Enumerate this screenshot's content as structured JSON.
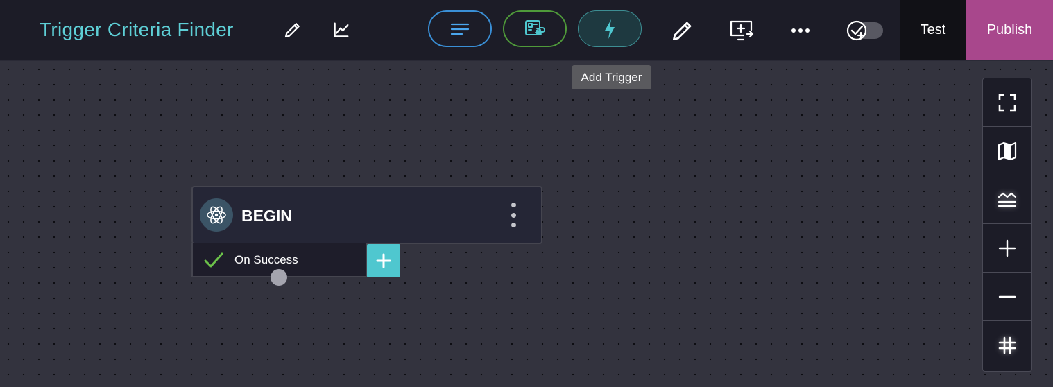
{
  "header": {
    "title": "Trigger Criteria Finder",
    "title_color": "#5ecfd6",
    "edit_title_icon": "pencil-icon",
    "analytics_icon": "chart-line-icon",
    "pills": [
      {
        "name": "text-lines-icon",
        "border": "#3a8fd6"
      },
      {
        "name": "linked-badge-icon",
        "border": "#4f9a3a"
      },
      {
        "name": "lightning-bolt-icon",
        "border": "#3d8e93",
        "fill": "#1e3940"
      }
    ],
    "tools": [
      "pencil-icon",
      "screen-share-icon",
      "more-dots-icon",
      "check-add-toggle-icon"
    ],
    "test_label": "Test",
    "publish_label": "Publish",
    "publish_color": "#a8478c"
  },
  "tooltip": {
    "text": "Add Trigger"
  },
  "node": {
    "title": "BEGIN",
    "icon": "atom-icon",
    "menu_icon": "vertical-dots-icon",
    "outcome_label": "On Success",
    "outcome_icon": "checkmark-icon",
    "add_icon": "plus-icon",
    "add_color": "#4fc7cf"
  },
  "canvas_controls": [
    "fullscreen-icon",
    "map-icon",
    "align-icon",
    "zoom-in-icon",
    "zoom-out-icon",
    "grid-icon"
  ]
}
